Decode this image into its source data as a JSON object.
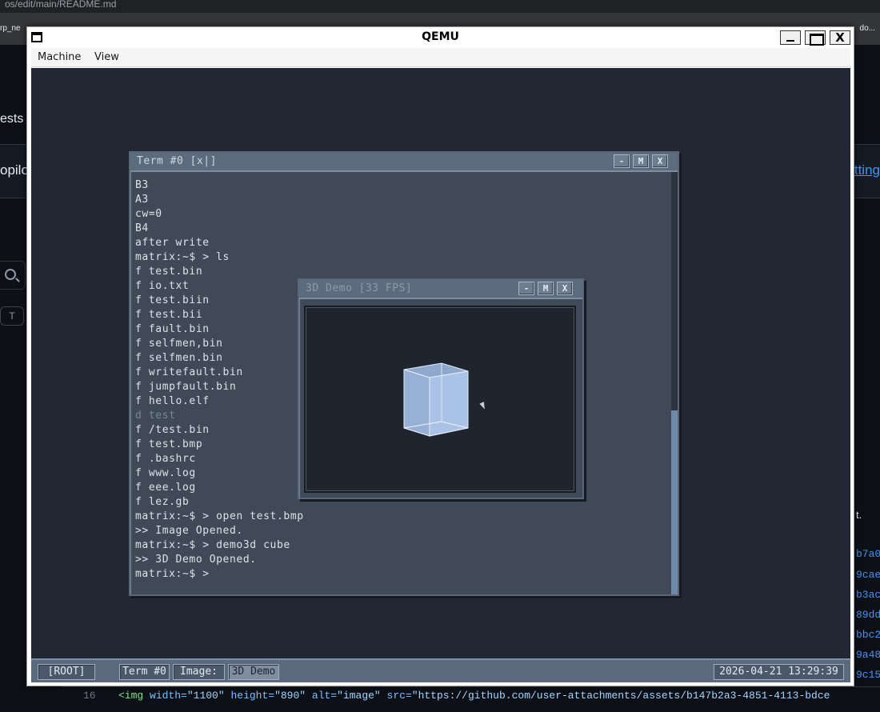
{
  "host": {
    "url_text": "os/edit/main/README.md",
    "tab_left": "rp_ne",
    "tab_right": "do...",
    "nav_text": "ests",
    "copilot_text": "opilo",
    "settings_text": "etting",
    "search_icon": "search-icon",
    "t_key": "T",
    "right_text": "t.",
    "hashes": [
      "b7a0",
      "9cae",
      "b3ac",
      "89dd",
      "bbc2",
      "9a48",
      "9c15"
    ],
    "code_line": {
      "number": "16",
      "tag_open": "<img",
      "attr_width": "width=",
      "val_width": "\"1100\"",
      "attr_height": "height=",
      "val_height": "\"890\"",
      "attr_alt": "alt=",
      "val_alt": "\"image\"",
      "attr_src": "src=",
      "val_src": "\"https://github.com/user-attachments/assets/b147b2a3-4851-4113-bdce"
    }
  },
  "qemu": {
    "title": "QEMU",
    "close_glyph": "X",
    "menu": [
      "Machine",
      "View"
    ]
  },
  "guest": {
    "terminal": {
      "title": "Term #0 [x|]",
      "buttons": [
        "-",
        "M",
        "X"
      ],
      "lines": [
        {
          "text": "B3",
          "dim": false
        },
        {
          "text": "A3",
          "dim": false
        },
        {
          "text": "cw=0",
          "dim": false
        },
        {
          "text": "B4",
          "dim": false
        },
        {
          "text": "after write",
          "dim": false
        },
        {
          "text": "matrix:~$ > ls",
          "dim": false
        },
        {
          "text": "f test.bin",
          "dim": false
        },
        {
          "text": "f io.txt",
          "dim": false
        },
        {
          "text": "f test.biin",
          "dim": false
        },
        {
          "text": "f test.bii",
          "dim": false
        },
        {
          "text": "f fault.bin",
          "dim": false
        },
        {
          "text": "f selfmen,bin",
          "dim": false
        },
        {
          "text": "f selfmen.bin",
          "dim": false
        },
        {
          "text": "f writefault.bin",
          "dim": false
        },
        {
          "text": "f jumpfault.bin",
          "dim": false
        },
        {
          "text": "f hello.elf",
          "dim": false
        },
        {
          "text": "d test",
          "dim": true
        },
        {
          "text": "f /test.bin",
          "dim": false
        },
        {
          "text": "f test.bmp",
          "dim": false
        },
        {
          "text": "f .bashrc",
          "dim": false
        },
        {
          "text": "f www.log",
          "dim": false
        },
        {
          "text": "f eee.log",
          "dim": false
        },
        {
          "text": "f lez.gb",
          "dim": false
        },
        {
          "text": "matrix:~$ > open test.bmp",
          "dim": false
        },
        {
          "text": ">> Image Opened.",
          "dim": false
        },
        {
          "text": "matrix:~$ > demo3d cube",
          "dim": false
        },
        {
          "text": ">> 3D Demo Opened.",
          "dim": false
        },
        {
          "text": "matrix:~$ >",
          "dim": false
        }
      ]
    },
    "demo": {
      "title": "3D Demo [33 FPS]",
      "buttons": [
        "-",
        "M",
        "X"
      ],
      "cube_color": "#a9c2e6"
    },
    "taskbar": {
      "root": "[ROOT]",
      "items": [
        "Term #0",
        "Image:",
        "3D Demo"
      ],
      "active_item": "3D Demo",
      "clock": "2026-04-21 13:29:39"
    }
  }
}
